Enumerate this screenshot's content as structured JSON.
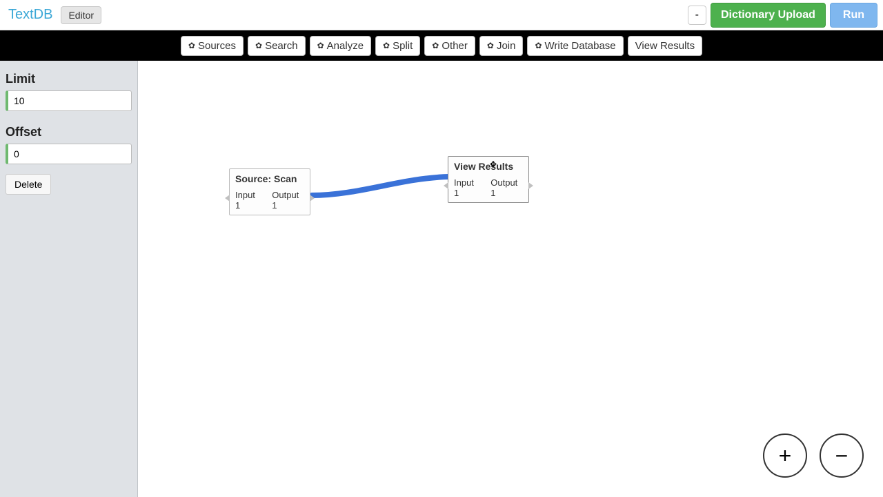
{
  "header": {
    "brand": "TextDB",
    "editor_label": "Editor",
    "minus_label": "-",
    "dictionary_upload_label": "Dictionary Upload",
    "run_label": "Run"
  },
  "toolbar": {
    "sources": "Sources",
    "search": "Search",
    "analyze": "Analyze",
    "split": "Split",
    "other": "Other",
    "join": "Join",
    "write_db": "Write Database",
    "view_results": "View Results"
  },
  "sidebar": {
    "limit_label": "Limit",
    "limit_value": "10",
    "offset_label": "Offset",
    "offset_value": "0",
    "delete_label": "Delete"
  },
  "nodes": {
    "source": {
      "title": "Source: Scan",
      "input": "Input 1",
      "output": "Output 1"
    },
    "view": {
      "title": "View Results",
      "input": "Input 1",
      "output": "Output 1"
    }
  },
  "zoom": {
    "in": "+",
    "out": "−"
  }
}
